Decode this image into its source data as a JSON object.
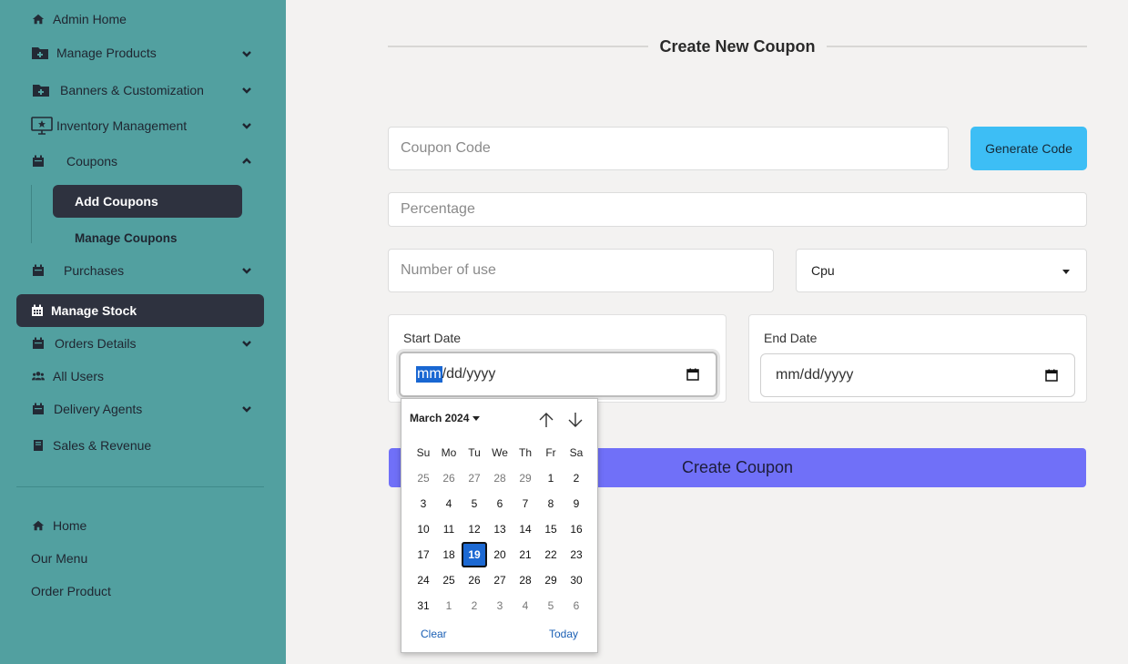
{
  "sidebar": {
    "admin_home": "Admin Home",
    "manage_products": "Manage Products",
    "banners": "Banners & Customization",
    "inventory": "Inventory Management",
    "coupons": "Coupons",
    "add_coupons": "Add Coupons",
    "manage_coupons": "Manage Coupons",
    "purchases": "Purchases",
    "manage_stock": "Manage Stock",
    "orders_details": "Orders Details",
    "all_users": "All Users",
    "delivery_agents": "Delivery Agents",
    "sales_revenue": "Sales & Revenue",
    "home": "Home",
    "our_menu": "Our Menu",
    "order_product": "Order Product"
  },
  "form": {
    "title": "Create New Coupon",
    "coupon_code_placeholder": "Coupon Code",
    "generate_code_label": "Generate Code",
    "percentage_placeholder": "Percentage",
    "number_of_use_placeholder": "Number of use",
    "category_selected": "Cpu",
    "start_date_label": "Start Date",
    "end_date_label": "End Date",
    "date_segment_month": "mm",
    "date_rest": "/dd/yyyy",
    "date_placeholder": "mm/dd/yyyy",
    "create_label": "Create Coupon"
  },
  "calendar": {
    "month_label": "March 2024",
    "weekdays": [
      "Su",
      "Mo",
      "Tu",
      "We",
      "Th",
      "Fr",
      "Sa"
    ],
    "weeks": [
      [
        "25",
        "26",
        "27",
        "28",
        "29",
        "1",
        "2"
      ],
      [
        "3",
        "4",
        "5",
        "6",
        "7",
        "8",
        "9"
      ],
      [
        "10",
        "11",
        "12",
        "13",
        "14",
        "15",
        "16"
      ],
      [
        "17",
        "18",
        "19",
        "20",
        "21",
        "22",
        "23"
      ],
      [
        "24",
        "25",
        "26",
        "27",
        "28",
        "29",
        "30"
      ],
      [
        "31",
        "1",
        "2",
        "3",
        "4",
        "5",
        "6"
      ]
    ],
    "today": "19",
    "clear_label": "Clear",
    "today_label": "Today"
  },
  "colors": {
    "sidebar_bg": "#52a0a0",
    "active_pill": "#2e323f",
    "generate_button": "#3dbef5",
    "create_button": "#7070f8",
    "calendar_selected": "#1c69d3"
  }
}
